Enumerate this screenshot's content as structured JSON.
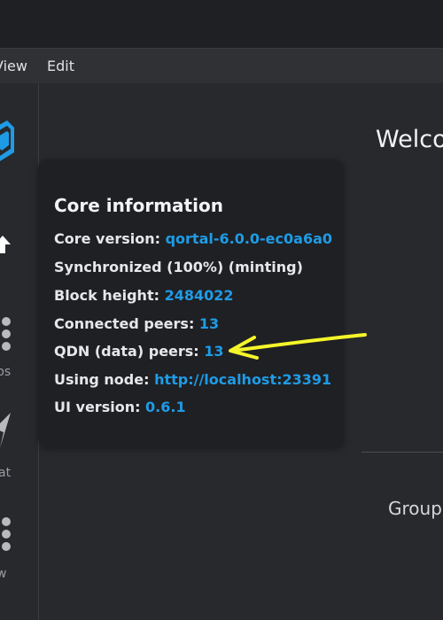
{
  "menu": {
    "view_label": "View",
    "edit_label": "Edit"
  },
  "sidebar": {
    "items": [
      {
        "label": "",
        "icon": "cube-logo-icon"
      },
      {
        "label": "",
        "icon": "home-icon"
      },
      {
        "label": "ps",
        "icon": "apps-dots-icon"
      },
      {
        "label": "at",
        "icon": "chat-send-icon"
      },
      {
        "label": "w",
        "icon": "dev-dots-icon"
      }
    ]
  },
  "main": {
    "welcome_text": "Welco",
    "groups_text": "Group"
  },
  "core_info": {
    "title": "Core information",
    "core_version_label": "Core version: ",
    "core_version_value": "qortal-6.0.0-ec0a6a0",
    "sync_status": "Synchronized (100%) (minting)",
    "block_height_label": "Block height: ",
    "block_height_value": "2484022",
    "connected_peers_label": "Connected peers: ",
    "connected_peers_value": "13",
    "qdn_peers_label": "QDN (data) peers: ",
    "qdn_peers_value": "13",
    "using_node_label": "Using node: ",
    "using_node_value": "http://localhost:23391",
    "ui_version_label": "UI version: ",
    "ui_version_value": "0.6.1"
  },
  "colors": {
    "accent": "#1f9be6",
    "annotation": "#f5f52a",
    "logo": "#1f9be6"
  }
}
